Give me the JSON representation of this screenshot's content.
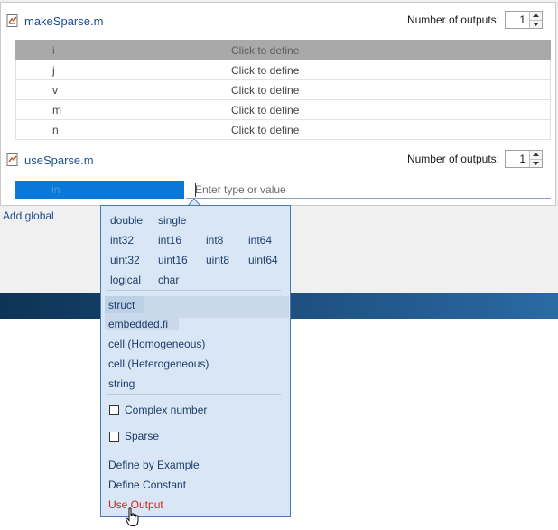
{
  "functions": [
    {
      "name": "makeSparse.m",
      "outputs_label": "Number of outputs:",
      "outputs_value": "1",
      "args": [
        {
          "name": "i",
          "type": "Click to define"
        },
        {
          "name": "j",
          "type": "Click to define"
        },
        {
          "name": "v",
          "type": "Click to define"
        },
        {
          "name": "m",
          "type": "Click to define"
        },
        {
          "name": "n",
          "type": "Click to define"
        }
      ]
    },
    {
      "name": "useSparse.m",
      "outputs_label": "Number of outputs:",
      "outputs_value": "1",
      "edit_arg_name": "in",
      "edit_placeholder": "Enter type or value"
    }
  ],
  "add_global_label": "Add global",
  "dropdown": {
    "types_row1": [
      "double",
      "single"
    ],
    "types_row2": [
      "int32",
      "int16",
      "int8",
      "int64"
    ],
    "types_row3": [
      "uint32",
      "uint16",
      "uint8",
      "uint64"
    ],
    "types_row4": [
      "logical",
      "char"
    ],
    "compound": [
      "struct",
      "embedded.fi",
      "cell (Homogeneous)",
      "cell (Heterogeneous)",
      "string"
    ],
    "checks": [
      "Complex number",
      "Sparse"
    ],
    "actions": [
      "Define by Example",
      "Define Constant",
      "Use Output"
    ],
    "active_color": "#d81e1e"
  }
}
